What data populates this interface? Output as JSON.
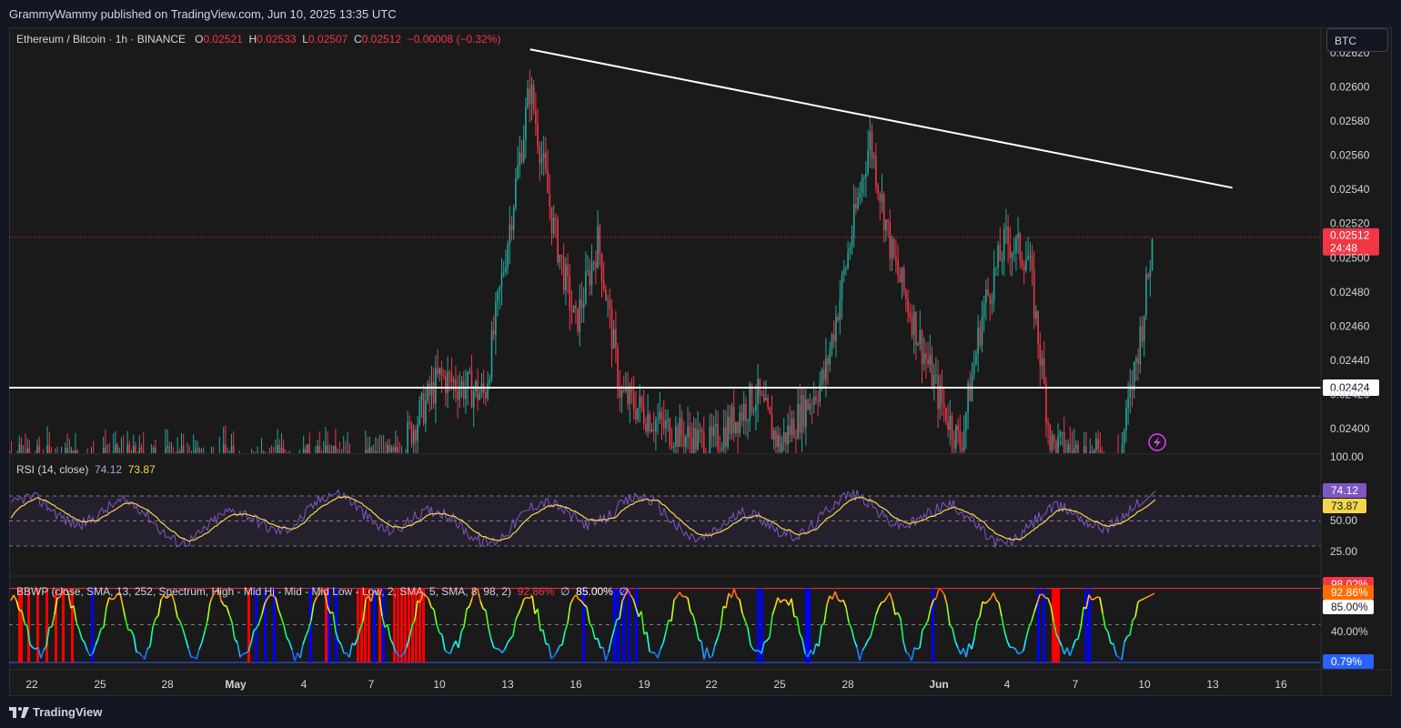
{
  "header": {
    "published": "GrammyWammy published on TradingView.com, Jun 10, 2025 13:35 UTC"
  },
  "symbol": {
    "name": "Ethereum / Bitcoin · 1h · BINANCE",
    "o_label": "O",
    "o": "0.02521",
    "h_label": "H",
    "h": "0.02533",
    "l_label": "L",
    "l": "0.02507",
    "c_label": "C",
    "c": "0.02512",
    "change": "−0.00008 (−0.32%)"
  },
  "currency_button": "BTC",
  "price_tags": {
    "current": "0.02512",
    "countdown": "24:48",
    "support": "0.02424"
  },
  "rsi": {
    "title": "RSI (14, close)",
    "value": "74.12",
    "ma": "73.87",
    "levels": [
      "100.00",
      "50.00",
      "25.00"
    ]
  },
  "bbwp": {
    "title": "BBWP (close, SMA, 13, 252, Spectrum, High - Mid Hi - Mid - Mid Low - Low, 2, SMA, 5, SMA, 8, 98, 2)",
    "value": "92.86%",
    "sym1": "∅",
    "level": "85.00%",
    "sym2": "∅",
    "tags": [
      "98.02%",
      "92.86%",
      "85.00%",
      "40.00%",
      "0.79%"
    ]
  },
  "footer": {
    "brand": "TradingView",
    "logo": "TV-logo-icon"
  },
  "colors": {
    "up": "#26a69a",
    "down": "#f23645",
    "rsi": "#7e57c2",
    "rsi_ma": "#f5d64a",
    "trendline": "#ffffff"
  },
  "chart_data": {
    "type": "candlestick",
    "title": "Ethereum / Bitcoin · 1h · BINANCE",
    "price_axis": [
      "0.02620",
      "0.02600",
      "0.02580",
      "0.02560",
      "0.02540",
      "0.02520",
      "0.02500",
      "0.02480",
      "0.02460",
      "0.02440",
      "0.02420",
      "0.02400"
    ],
    "ylim": [
      0.02388,
      0.02628
    ],
    "time_axis": [
      "22",
      "25",
      "28",
      "May",
      "4",
      "7",
      "10",
      "13",
      "16",
      "19",
      "22",
      "25",
      "28",
      "Jun",
      "4",
      "7",
      "10",
      "13",
      "16"
    ],
    "last_close": 0.02512,
    "support_level": 0.02424,
    "descending_trendline": [
      {
        "x": "May 14",
        "y": 0.02622
      },
      {
        "x": "Jun 14",
        "y": 0.02541
      }
    ],
    "approx_path": [
      {
        "x": "Apr 20",
        "y": 0.0238
      },
      {
        "x": "May 8",
        "y": 0.0238
      },
      {
        "x": "May 10",
        "y": 0.0243
      },
      {
        "x": "May 12",
        "y": 0.0242
      },
      {
        "x": "May 14",
        "y": 0.026
      },
      {
        "x": "May 15",
        "y": 0.0252
      },
      {
        "x": "May 16",
        "y": 0.0246
      },
      {
        "x": "May 17",
        "y": 0.0251
      },
      {
        "x": "May 18",
        "y": 0.0242
      },
      {
        "x": "May 20",
        "y": 0.024
      },
      {
        "x": "May 22",
        "y": 0.0239
      },
      {
        "x": "May 24",
        "y": 0.0242
      },
      {
        "x": "May 25",
        "y": 0.0239
      },
      {
        "x": "May 27",
        "y": 0.0243
      },
      {
        "x": "May 29",
        "y": 0.0257
      },
      {
        "x": "May 30",
        "y": 0.025
      },
      {
        "x": "May 31",
        "y": 0.0246
      },
      {
        "x": "Jun 1",
        "y": 0.0242
      },
      {
        "x": "Jun 2",
        "y": 0.0239
      },
      {
        "x": "Jun 3",
        "y": 0.0247
      },
      {
        "x": "Jun 4",
        "y": 0.0251
      },
      {
        "x": "Jun 5",
        "y": 0.025
      },
      {
        "x": "Jun 6",
        "y": 0.0239
      },
      {
        "x": "Jun 9",
        "y": 0.0238
      },
      {
        "x": "Jun 10",
        "y": 0.0246
      },
      {
        "x": "Jun 10.5",
        "y": 0.02512
      }
    ],
    "rsi_last": 74.12,
    "rsi_ma_last": 73.87,
    "bbwp_last": 92.86
  }
}
